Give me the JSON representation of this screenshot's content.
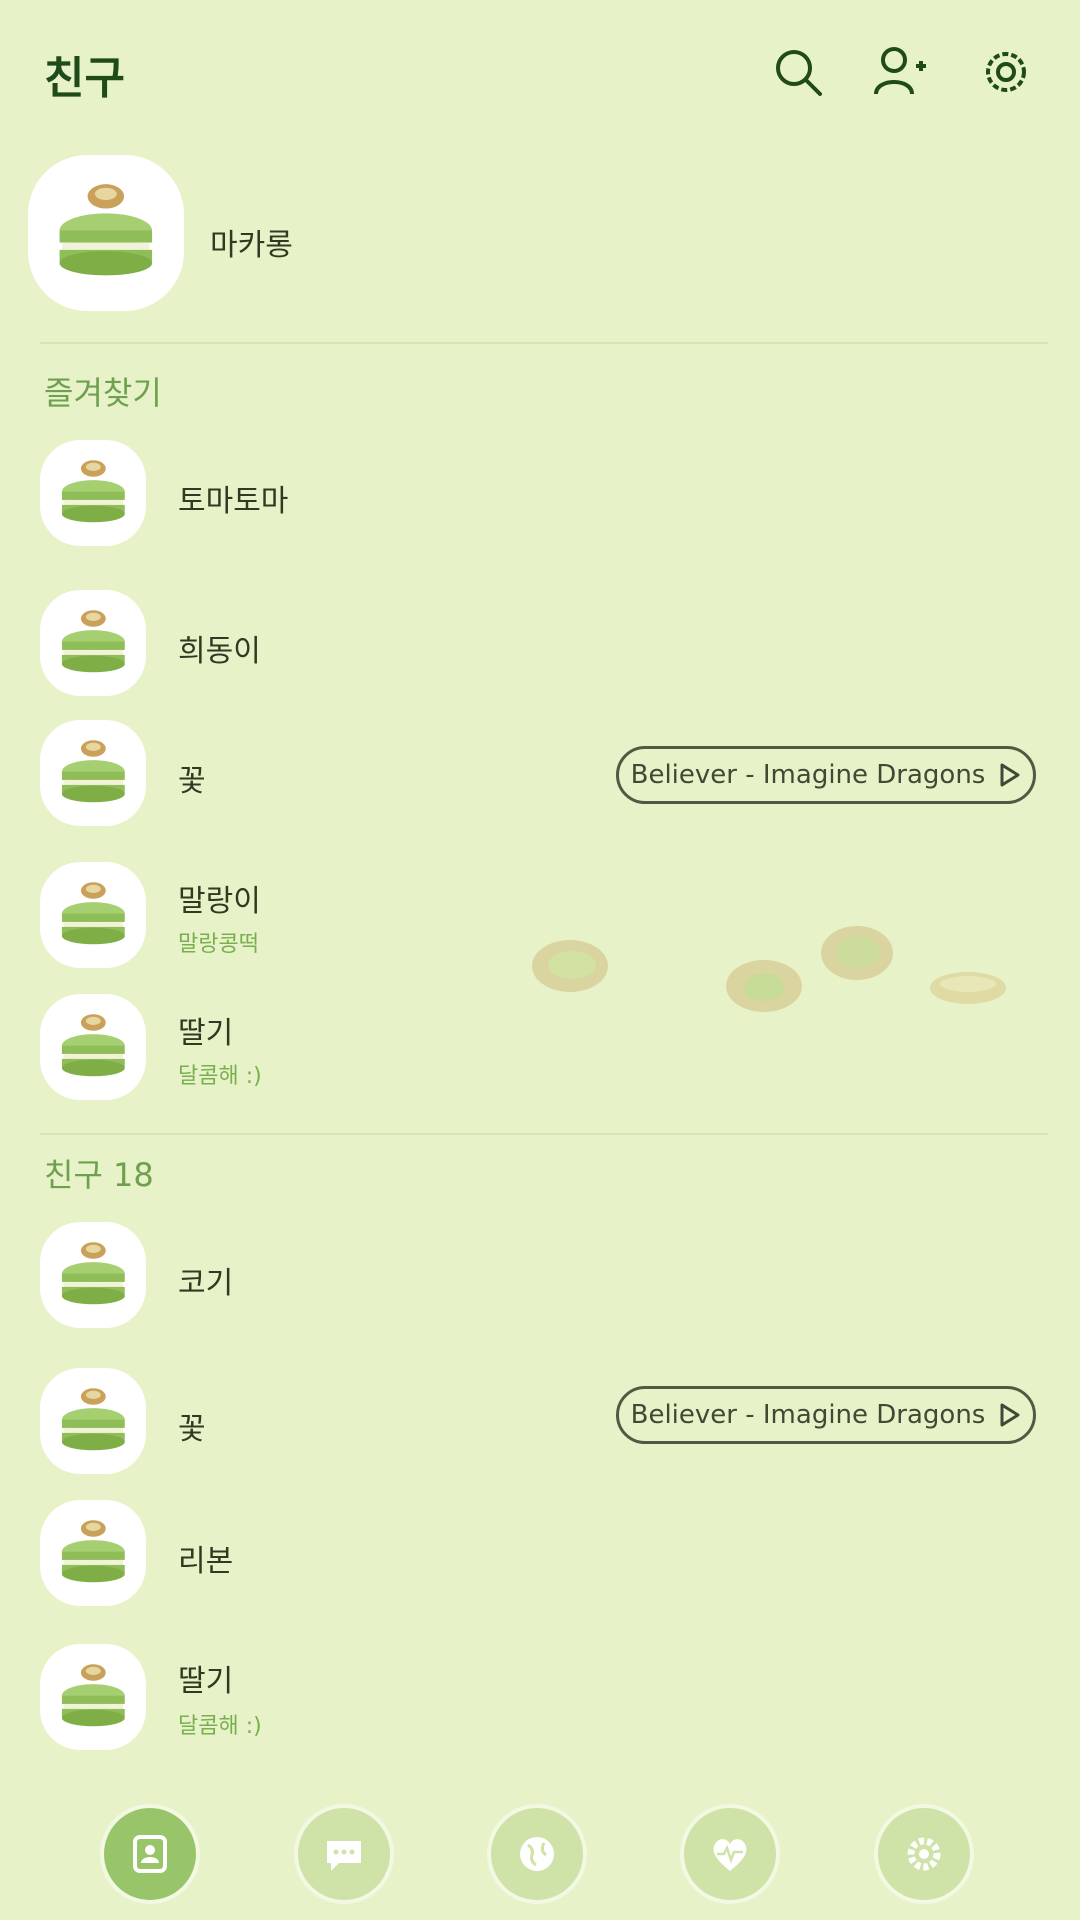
{
  "header": {
    "title": "친구"
  },
  "my_profile": {
    "name": "마카롱"
  },
  "favorites": {
    "label": "즐겨찾기",
    "items": [
      {
        "name": "토마토마",
        "status": ""
      },
      {
        "name": "희동이",
        "status": ""
      },
      {
        "name": "꽃",
        "status": "",
        "music": "Believer - Imagine Dragons"
      },
      {
        "name": "말랑이",
        "status": "말랑콩떡"
      },
      {
        "name": "딸기",
        "status": "달콤해 :)"
      }
    ]
  },
  "friends": {
    "label": "친구 18",
    "items": [
      {
        "name": "코기",
        "status": ""
      },
      {
        "name": "꽃",
        "status": "",
        "music": "Believer - Imagine Dragons"
      },
      {
        "name": "리본",
        "status": ""
      },
      {
        "name": "딸기",
        "status": "달콤해 :)"
      }
    ]
  },
  "bottom_nav": {
    "active": "friends",
    "tabs": [
      "friends-icon",
      "chat-icon",
      "globe-icon",
      "heart-icon",
      "gear-icon"
    ]
  },
  "colors": {
    "background": "#e8f2c8",
    "accent": "#98c56a",
    "text": "#2f3a22",
    "section": "#6ea050"
  }
}
